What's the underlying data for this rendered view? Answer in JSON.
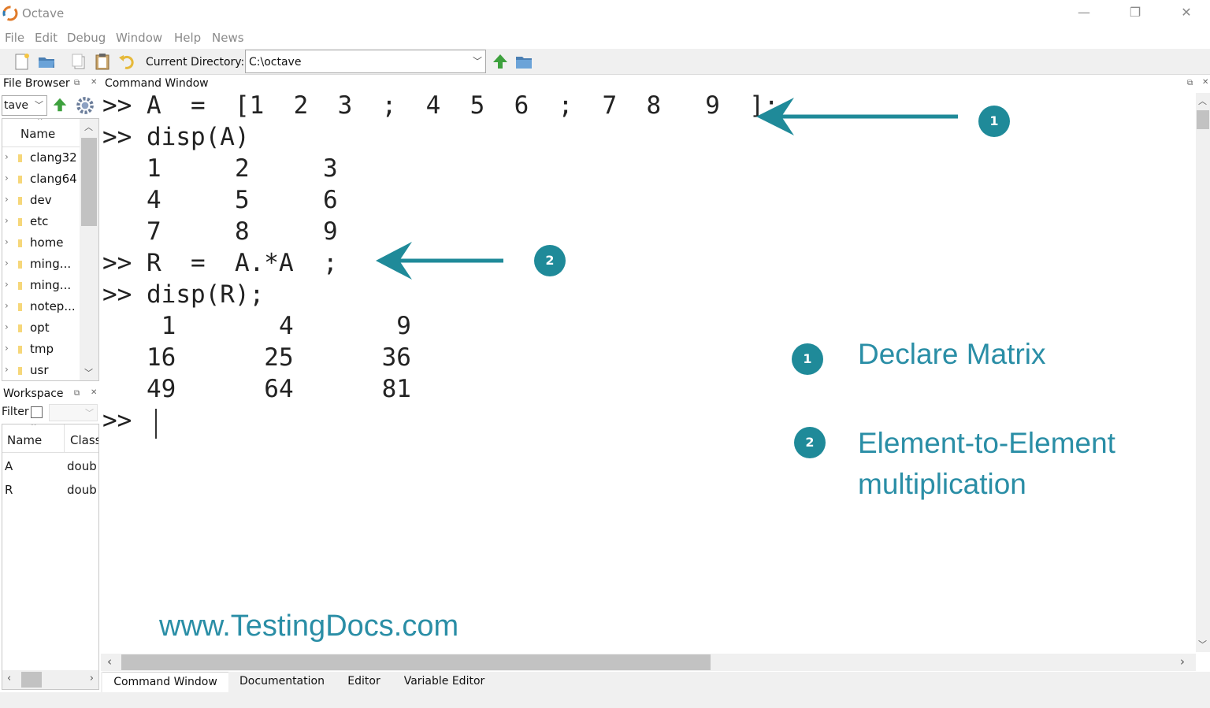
{
  "window": {
    "title": "Octave",
    "minimize_glyph": "—",
    "restore_glyph": "❐",
    "close_glyph": "✕"
  },
  "menu": [
    "File",
    "Edit",
    "Debug",
    "Window",
    "Help",
    "News"
  ],
  "toolbar": {
    "icons": [
      "new-file-icon",
      "open-folder-icon",
      "copy-icon",
      "paste-icon",
      "undo-icon"
    ],
    "current_directory_label": "Current Directory:",
    "current_directory_value": "C:\\octave",
    "nav_icons": [
      "parent-directory-icon",
      "browse-folder-icon"
    ]
  },
  "file_browser": {
    "title": "File Browser",
    "path_value": "tave",
    "column_header": "Name",
    "items": [
      "clang32",
      "clang64",
      "dev",
      "etc",
      "home",
      "ming...",
      "ming...",
      "notep...",
      "opt",
      "tmp",
      "usr"
    ]
  },
  "workspace": {
    "title": "Workspace",
    "filter_label": "Filter",
    "columns": [
      "Name",
      "Class"
    ],
    "rows": [
      {
        "name": "A",
        "class": "doub"
      },
      {
        "name": "R",
        "class": "doub"
      }
    ]
  },
  "command_window": {
    "title": "Command Window",
    "lines": [
      ">> A  =  [1  2  3  ;  4  5  6  ;  7  8   9  ];",
      ">> disp(A)",
      "   1     2     3",
      "   4     5     6",
      "   7     8     9",
      ">> R  =  A.*A  ;",
      ">> disp(R);",
      "    1       4       9",
      "   16      25      36",
      "   49      64      81",
      ">>"
    ]
  },
  "annotations": {
    "marker_1": "1",
    "marker_2": "2",
    "legend_1": "Declare Matrix",
    "legend_2_line1": "Element-to-Element",
    "legend_2_line2": "multiplication",
    "accent_color": "#1f8a99"
  },
  "watermark": "www.TestingDocs.com",
  "bottom_tabs": [
    "Command Window",
    "Documentation",
    "Editor",
    "Variable Editor"
  ]
}
